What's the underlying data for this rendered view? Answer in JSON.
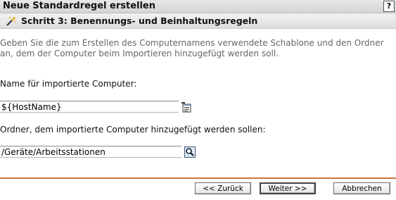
{
  "window": {
    "title": "Neue Standardregel erstellen",
    "help_label": "?"
  },
  "step": {
    "title": "Schritt 3: Benennungs- und Beinhaltungsregeln",
    "icon": "wand-icon"
  },
  "description": "Geben Sie die zum Erstellen des Computernamens verwendete Schablone und den Ordner an, dem der Computer beim Importieren hinzugefügt werden soll.",
  "name_field": {
    "label": "Name für importierte Computer:",
    "value": "${HostName}",
    "icon": "variable-picker-icon"
  },
  "folder_field": {
    "label": "Ordner, dem importierte Computer hinzugefügt werden sollen:",
    "value": "/Geräte/Arbeitsstationen",
    "icon": "browse-search-icon"
  },
  "buttons": {
    "back": "<< Zurück",
    "next": "Weiter >>",
    "cancel": "Abbrechen"
  },
  "colors": {
    "divider": "#c8743c",
    "description_text": "#666666"
  }
}
